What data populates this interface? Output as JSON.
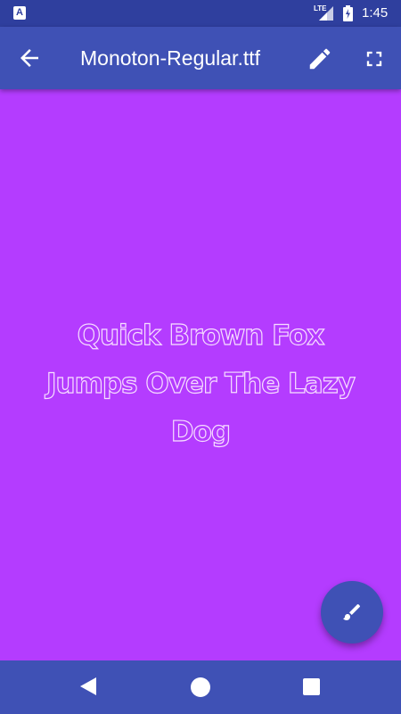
{
  "status_bar": {
    "notification_icon": "A",
    "network": "LTE",
    "time": "1:45",
    "icons": [
      "app-notification-icon",
      "signal-icon",
      "battery-icon"
    ]
  },
  "app_bar": {
    "title": "Monoton-Regular.ttf",
    "icons": [
      "back-arrow-icon",
      "pencil-icon",
      "fullscreen-icon"
    ],
    "color": "#3f51b5"
  },
  "preview": {
    "text": "Quick Brown Fox\nJumps Over The Lazy\nDog",
    "background": "#b43cff",
    "text_color": "#f6ddff"
  },
  "fab": {
    "icon": "paintbrush-icon"
  },
  "nav_bar": {
    "icons": [
      "nav-back-icon",
      "nav-home-icon",
      "nav-recents-icon"
    ]
  },
  "colors": {
    "status_bar": "#2f3f9e",
    "primary": "#3f51b5",
    "canvas": "#b43cff"
  }
}
